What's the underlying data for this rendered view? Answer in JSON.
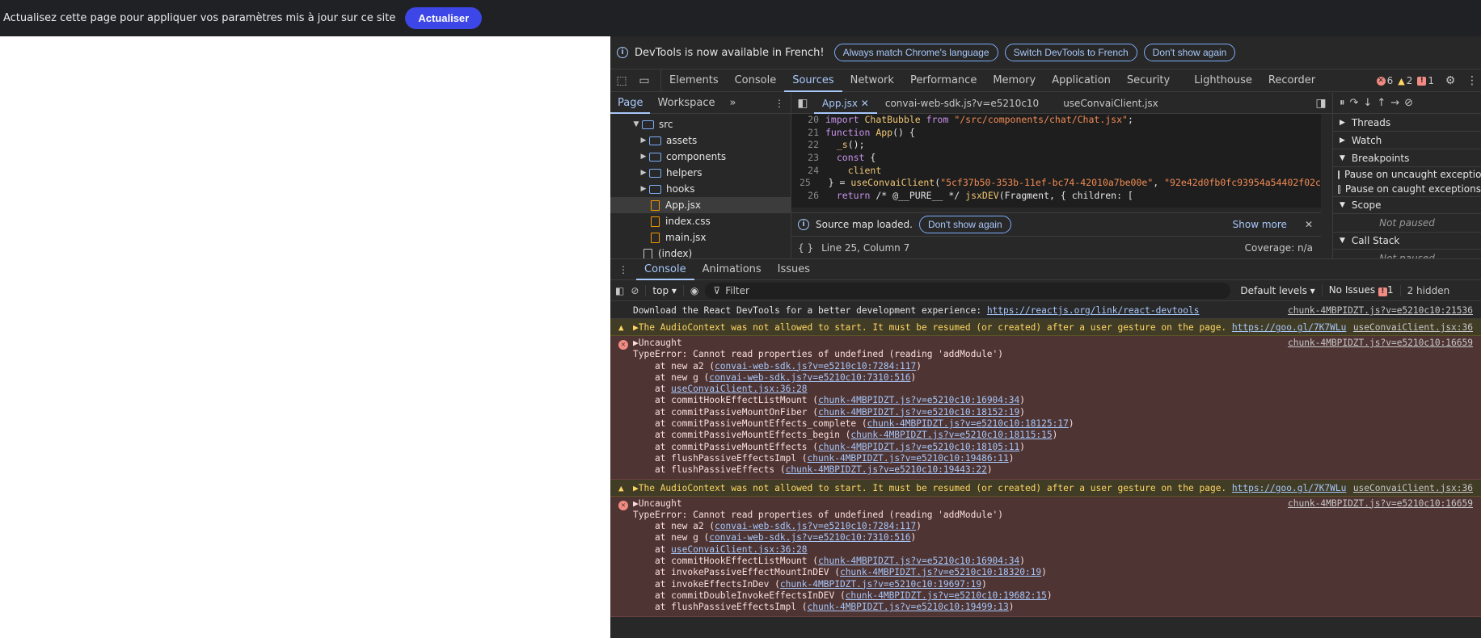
{
  "topbar": {
    "message": "Actualisez cette page pour appliquer vos paramètres mis à jour sur ce site",
    "button": "Actualiser"
  },
  "infobar": {
    "text": "DevTools is now available in French!",
    "btn1": "Always match Chrome's language",
    "btn2": "Switch DevTools to French",
    "btn3": "Don't show again"
  },
  "tabs": [
    "Elements",
    "Console",
    "Sources",
    "Network",
    "Performance",
    "Memory",
    "Application",
    "Security",
    "Lighthouse",
    "Recorder"
  ],
  "counts": {
    "errors": "6",
    "warnings": "2",
    "issues": "1"
  },
  "nav": {
    "tabs": [
      "Page",
      "Workspace"
    ],
    "more": "»",
    "tree": [
      {
        "label": "src",
        "type": "folder",
        "depth": 3,
        "caret": "▼"
      },
      {
        "label": "assets",
        "type": "folder",
        "depth": 4,
        "caret": "▶"
      },
      {
        "label": "components",
        "type": "folder",
        "depth": 4,
        "caret": "▶"
      },
      {
        "label": "helpers",
        "type": "folder",
        "depth": 4,
        "caret": "▶"
      },
      {
        "label": "hooks",
        "type": "folder",
        "depth": 4,
        "caret": "▶"
      },
      {
        "label": "App.jsx",
        "type": "file-orange",
        "depth": 4,
        "caret": "",
        "selected": true
      },
      {
        "label": "index.css",
        "type": "file-orange",
        "depth": 4,
        "caret": ""
      },
      {
        "label": "main.jsx",
        "type": "file-orange",
        "depth": 4,
        "caret": ""
      },
      {
        "label": "(index)",
        "type": "file",
        "depth": 3,
        "caret": ""
      }
    ]
  },
  "editor": {
    "tabs": [
      "App.jsx",
      "convai-web-sdk.js?v=e5210c10",
      "useConvaiClient.jsx"
    ],
    "lines": [
      {
        "n": "20",
        "html": "<span class='kw'>import</span> <span class='var'>ChatBubble</span> <span class='kw'>from</span> <span class='str'>\"/src/components/chat/Chat.jsx\"</span>;"
      },
      {
        "n": "21",
        "html": "<span class='kw'>function</span> <span class='fn'>App</span>() {"
      },
      {
        "n": "22",
        "html": "  <span class='fn'>_s</span>();"
      },
      {
        "n": "23",
        "html": "  <span class='kw'>const</span> {"
      },
      {
        "n": "24",
        "html": "    <span class='var'>client</span>"
      },
      {
        "n": "25",
        "html": "  } = <span class='fn'>useConvaiClient</span>(<span class='str'>\"5cf37b50-353b-11ef-bc74-42010a7be00e\"</span>, <span class='str'>\"92e42d0fb0fc93954a54402f02c</span>"
      },
      {
        "n": "26",
        "html": "  <span class='kw'>return</span> <span class='ct'>/* @__PURE__ */</span> <span class='fn'>jsxDEV</span>(Fragment, { children: ["
      }
    ],
    "srcmap": "Source map loaded.",
    "srcmap_btn": "Don't show again",
    "show_more": "Show more",
    "position": "Line 25, Column 7",
    "coverage": "Coverage: n/a"
  },
  "debug": {
    "sections": [
      "Threads",
      "Watch",
      "Breakpoints"
    ],
    "uncaught": "Pause on uncaught exceptions",
    "caught": "Pause on caught exceptions",
    "scope": "Scope",
    "callstack": "Call Stack",
    "not_paused": "Not paused"
  },
  "drawer": {
    "tabs": [
      "Console",
      "Animations",
      "Issues"
    ]
  },
  "console": {
    "context": "top",
    "filter": "Filter",
    "levels": "Default levels",
    "no_issues": "No Issues",
    "issue_count": "1",
    "hidden": "2 hidden",
    "messages": [
      {
        "type": "info",
        "lines": [
          "Download the React DevTools for a better development experience: <a>https://reactjs.org/link/react-devtools</a>"
        ],
        "src": "chunk-4MBPIDZT.js?v=e5210c10:21536"
      },
      {
        "type": "warn",
        "lines": [
          "▶The AudioContext was not allowed to start. It must be resumed (or created) after a user gesture on the page. <a>https://goo.gl/7K7WLu</a>"
        ],
        "src": "useConvaiClient.jsx:36"
      },
      {
        "type": "err",
        "lines": [
          "▶Uncaught",
          "TypeError: Cannot read properties of undefined (reading 'addModule')",
          "    at new a2 (<a>convai-web-sdk.js?v=e5210c10:7284:117</a>)",
          "    at new g (<a>convai-web-sdk.js?v=e5210c10:7310:516</a>)",
          "    at <a>useConvaiClient.jsx:36:28</a>",
          "    at commitHookEffectListMount (<a>chunk-4MBPIDZT.js?v=e5210c10:16904:34</a>)",
          "    at commitPassiveMountOnFiber (<a>chunk-4MBPIDZT.js?v=e5210c10:18152:19</a>)",
          "    at commitPassiveMountEffects_complete (<a>chunk-4MBPIDZT.js?v=e5210c10:18125:17</a>)",
          "    at commitPassiveMountEffects_begin (<a>chunk-4MBPIDZT.js?v=e5210c10:18115:15</a>)",
          "    at commitPassiveMountEffects (<a>chunk-4MBPIDZT.js?v=e5210c10:18105:11</a>)",
          "    at flushPassiveEffectsImpl (<a>chunk-4MBPIDZT.js?v=e5210c10:19486:11</a>)",
          "    at flushPassiveEffects (<a>chunk-4MBPIDZT.js?v=e5210c10:19443:22</a>)"
        ],
        "src": "chunk-4MBPIDZT.js?v=e5210c10:16659"
      },
      {
        "type": "warn",
        "lines": [
          "▶The AudioContext was not allowed to start. It must be resumed (or created) after a user gesture on the page. <a>https://goo.gl/7K7WLu</a>"
        ],
        "src": "useConvaiClient.jsx:36"
      },
      {
        "type": "err",
        "lines": [
          "▶Uncaught",
          "TypeError: Cannot read properties of undefined (reading 'addModule')",
          "    at new a2 (<a>convai-web-sdk.js?v=e5210c10:7284:117</a>)",
          "    at new g (<a>convai-web-sdk.js?v=e5210c10:7310:516</a>)",
          "    at <a>useConvaiClient.jsx:36:28</a>",
          "    at commitHookEffectListMount (<a>chunk-4MBPIDZT.js?v=e5210c10:16904:34</a>)",
          "    at invokePassiveEffectMountInDEV (<a>chunk-4MBPIDZT.js?v=e5210c10:18320:19</a>)",
          "    at invokeEffectsInDev (<a>chunk-4MBPIDZT.js?v=e5210c10:19697:19</a>)",
          "    at commitDoubleInvokeEffectsInDEV (<a>chunk-4MBPIDZT.js?v=e5210c10:19682:15</a>)",
          "    at flushPassiveEffectsImpl (<a>chunk-4MBPIDZT.js?v=e5210c10:19499:13</a>)"
        ],
        "src": "chunk-4MBPIDZT.js?v=e5210c10:16659"
      }
    ]
  }
}
